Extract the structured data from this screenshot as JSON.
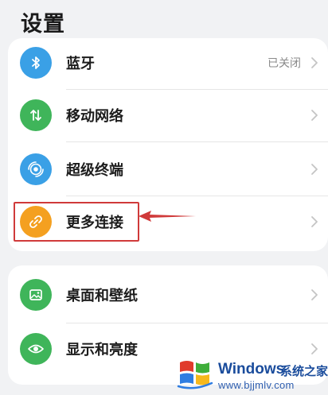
{
  "header": {
    "title": "设置"
  },
  "settings_group_1": {
    "items": [
      {
        "label": "蓝牙",
        "value": "已关闭",
        "icon": "bluetooth-icon",
        "color": "#3aa0e6"
      },
      {
        "label": "移动网络",
        "icon": "mobile-data-icon",
        "color": "#3fb55a"
      },
      {
        "label": "超级终端",
        "icon": "super-device-icon",
        "color": "#3aa0e6"
      },
      {
        "label": "更多连接",
        "icon": "link-icon",
        "color": "#f4a020"
      }
    ]
  },
  "settings_group_2": {
    "items": [
      {
        "label": "桌面和壁纸",
        "icon": "wallpaper-icon",
        "color": "#3fb55a"
      },
      {
        "label": "显示和亮度",
        "icon": "eye-icon",
        "color": "#3fb55a"
      }
    ]
  },
  "annotation": {
    "highlight_color": "#d03a3a"
  },
  "watermark": {
    "brand": "Windows",
    "cn_text": "系统之家",
    "url": "www.bjjmlv.com"
  }
}
